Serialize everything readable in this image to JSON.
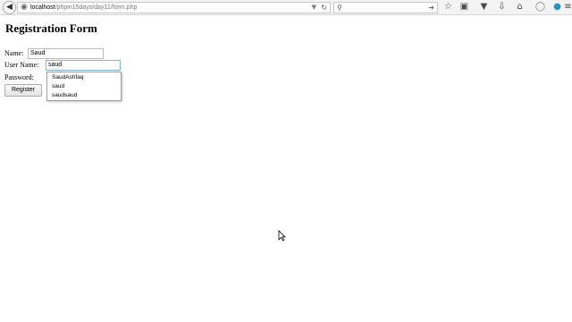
{
  "browser": {
    "url_host": "localhost",
    "url_path": "/phpin15days/day11/form.php",
    "icons": [
      "back-icon",
      "globe-icon",
      "dropdown-icon",
      "reload-icon",
      "search-icon",
      "arrow-right-icon",
      "star-icon",
      "clipboard-icon",
      "pocket-icon",
      "download-icon",
      "home-icon",
      "shield-icon",
      "sync-icon",
      "menu-icon"
    ]
  },
  "form": {
    "title": "Registration Form",
    "name_label": "Name:",
    "name_value": "Saud",
    "username_label": "User Name:",
    "username_value": "saud",
    "password_label": "Password:",
    "register_label": "Register",
    "autocomplete": [
      "SaudAshfaq",
      "saud",
      "saudsaud"
    ]
  }
}
